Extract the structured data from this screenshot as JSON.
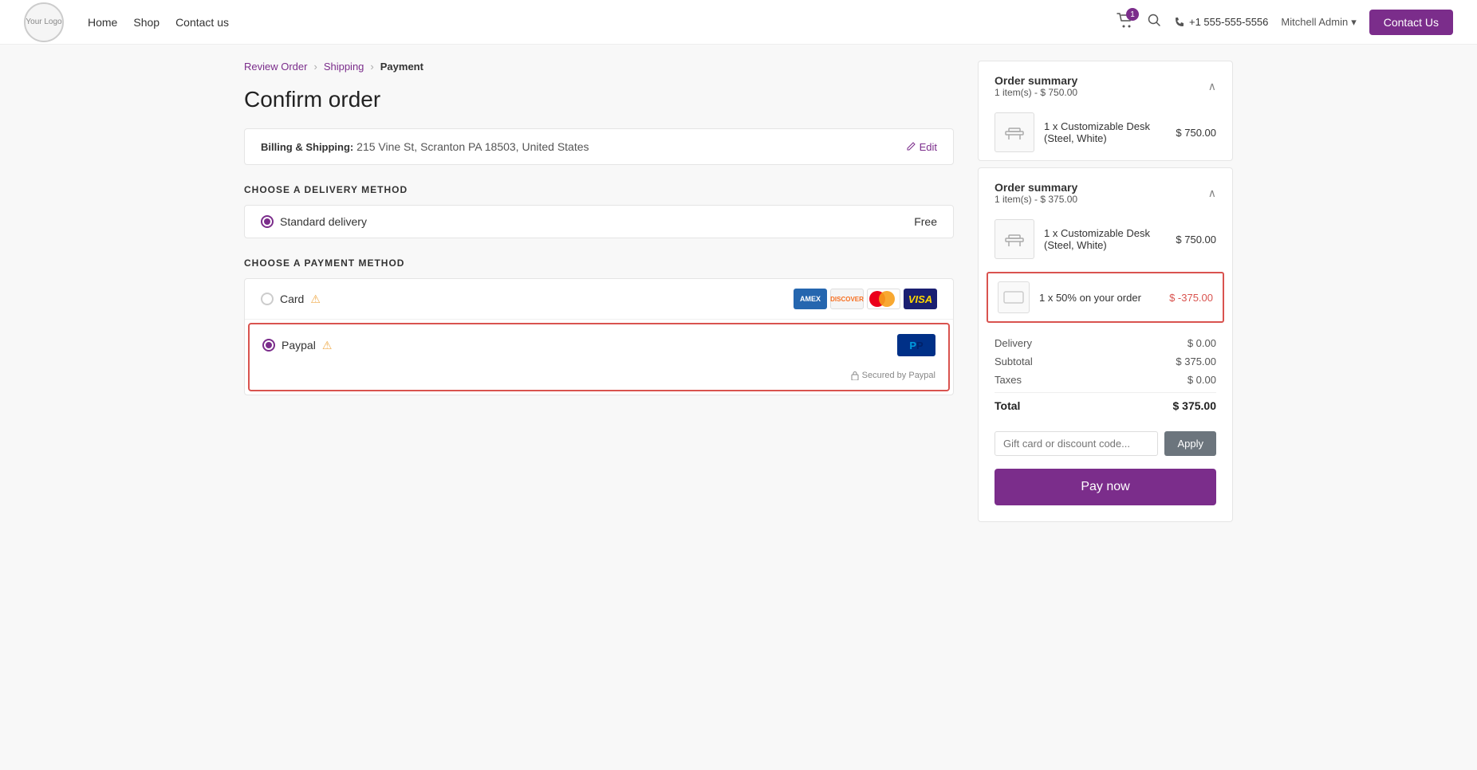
{
  "leftEdge": {},
  "header": {
    "logo_text": "Your Logo",
    "nav": [
      "Home",
      "Shop",
      "Contact us"
    ],
    "cart_badge": "1",
    "phone": "+1 555-555-5556",
    "admin_label": "Mitchell Admin",
    "contact_us_btn": "Contact Us"
  },
  "breadcrumb": {
    "step1": "Review Order",
    "step2": "Shipping",
    "step3": "Payment"
  },
  "page_title": "Confirm order",
  "billing": {
    "label": "Billing & Shipping:",
    "address": "215 Vine St, Scranton PA 18503, United States",
    "edit_label": "Edit"
  },
  "delivery": {
    "section_header": "CHOOSE A DELIVERY METHOD",
    "option_label": "Standard delivery",
    "option_price": "Free"
  },
  "payment": {
    "section_header": "CHOOSE A PAYMENT METHOD",
    "card_label": "Card",
    "paypal_label": "Paypal",
    "secured_text": "Secured by Paypal"
  },
  "order_summary_1": {
    "title": "Order summary",
    "subtitle": "1 item(s) - $ 750.00",
    "item_name": "1 x Customizable Desk (Steel, White)",
    "item_price": "$ 750.00"
  },
  "order_summary_2": {
    "title": "Order summary",
    "subtitle": "1 item(s) - $ 375.00",
    "item_name": "1 x Customizable Desk (Steel, White)",
    "item_price": "$ 750.00",
    "discount_name": "1 x 50% on your order",
    "discount_price": "$ -375.00"
  },
  "price_summary": {
    "delivery_label": "Delivery",
    "delivery_value": "$ 0.00",
    "subtotal_label": "Subtotal",
    "subtotal_value": "$ 375.00",
    "taxes_label": "Taxes",
    "taxes_value": "$ 0.00",
    "total_label": "Total",
    "total_value": "$ 375.00"
  },
  "discount_code": {
    "placeholder": "Gift card or discount code...",
    "apply_btn": "Apply"
  },
  "pay_now_btn": "Pay now"
}
